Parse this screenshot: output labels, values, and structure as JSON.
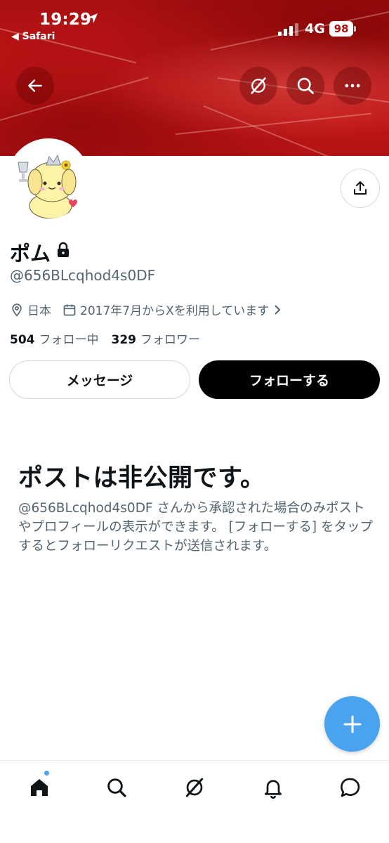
{
  "status_bar": {
    "time": "19:29",
    "back_app": "◀ Safari",
    "network": "4G",
    "battery": "98"
  },
  "profile": {
    "display_name": "ポム",
    "handle": "@656BLcqhod4s0DF",
    "location": "日本",
    "joined": "2017年7月からXを利用しています",
    "following_count": "504",
    "following_label": "フォロー中",
    "followers_count": "329",
    "followers_label": "フォロワー"
  },
  "actions": {
    "message_label": "メッセージ",
    "follow_label": "フォローする"
  },
  "private_notice": {
    "title": "ポストは非公開です。",
    "body": "@656BLcqhod4s0DF さんから承認された場合のみポストやプロフィールの表示ができます。 [フォローする] をタップするとフォローリクエストが送信されます。"
  },
  "colors": {
    "banner": "#c8191a",
    "accent": "#4aa3ef",
    "text_primary": "#0f1419",
    "text_secondary": "#536471"
  },
  "icons": {
    "nav": [
      "back-arrow-icon",
      "grok-icon",
      "search-icon",
      "more-icon"
    ],
    "tabs": [
      "home-icon",
      "search-icon",
      "grok-icon",
      "notifications-icon",
      "messages-icon"
    ]
  }
}
